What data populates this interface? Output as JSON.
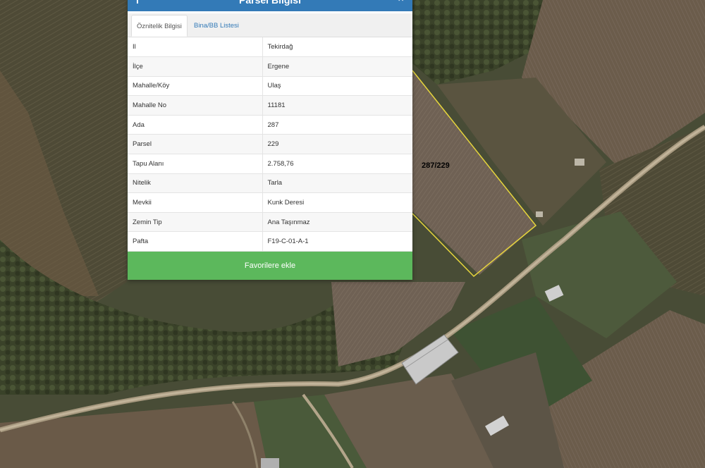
{
  "panel": {
    "title": "Parsel Bilgisi",
    "info_icon": "info-icon",
    "close_icon": "×"
  },
  "tabs": [
    {
      "label": "Öznitelik Bilgisi",
      "active": true
    },
    {
      "label": "Bina/BB Listesi",
      "active": false
    }
  ],
  "attributes": [
    {
      "key": "Il",
      "value": "Tekirdağ"
    },
    {
      "key": "İlçe",
      "value": "Ergene"
    },
    {
      "key": "Mahalle/Köy",
      "value": "Ulaş"
    },
    {
      "key": "Mahalle No",
      "value": "11181"
    },
    {
      "key": "Ada",
      "value": "287"
    },
    {
      "key": "Parsel",
      "value": "229"
    },
    {
      "key": "Tapu Alanı",
      "value": "2.758,76"
    },
    {
      "key": "Nitelik",
      "value": "Tarla"
    },
    {
      "key": "Mevkii",
      "value": "Kunk Deresi"
    },
    {
      "key": "Zemin Tip",
      "value": "Ana Taşınmaz"
    },
    {
      "key": "Pafta",
      "value": "F19-C-01-A-1"
    }
  ],
  "favorite_button": {
    "label": "Favorilere ekle"
  },
  "map": {
    "parcel_label": "287/229",
    "highlight_color": "#e6d53c"
  },
  "colors": {
    "header": "#337ab7",
    "button": "#5cb85c",
    "tab_link": "#337ab7"
  }
}
